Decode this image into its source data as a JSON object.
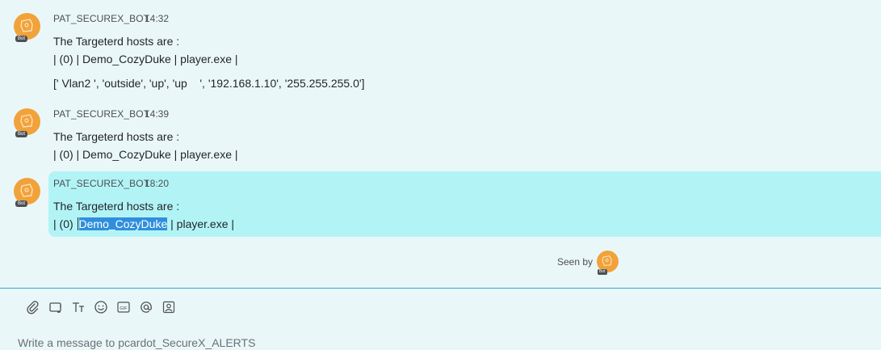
{
  "messages": [
    {
      "sender": "PAT_SECUREX_BOT",
      "time": "14:32",
      "avatar_badge": "Bot",
      "lines": [
        "The Targeterd hosts are :",
        "| (0) | Demo_CozyDuke | player.exe |",
        "[' Vlan2 ', 'outside', 'up', 'up    ', '192.168.1.10', '255.255.255.0']"
      ]
    },
    {
      "sender": "PAT_SECUREX_BOT",
      "time": "14:39",
      "avatar_badge": "Bot",
      "lines": [
        "The Targeterd hosts are :",
        "| (0) | Demo_CozyDuke | player.exe |"
      ]
    },
    {
      "sender": "PAT_SECUREX_BOT",
      "time": "18:20",
      "avatar_badge": "Bot",
      "lines": [
        "The Targeterd hosts are :"
      ],
      "line2_prefix": "| (0) ",
      "line2_selected": "Demo_CozyDuke",
      "line2_suffix": " | player.exe |"
    }
  ],
  "seen": {
    "label": "Seen by",
    "avatar_badge": "Bot"
  },
  "composer": {
    "placeholder": "Write a message to pcardot_SecureX_ALERTS",
    "tools": [
      "attach-icon",
      "screenshot-icon",
      "text-format-icon",
      "emoji-icon",
      "gif-icon",
      "mention-icon",
      "contact-icon"
    ]
  },
  "colors": {
    "background": "#eaf7f8",
    "highlight": "#b2f4f6",
    "selection": "#2f8fdd",
    "avatar": "#f2a23a",
    "divider": "#3aa6c4"
  }
}
